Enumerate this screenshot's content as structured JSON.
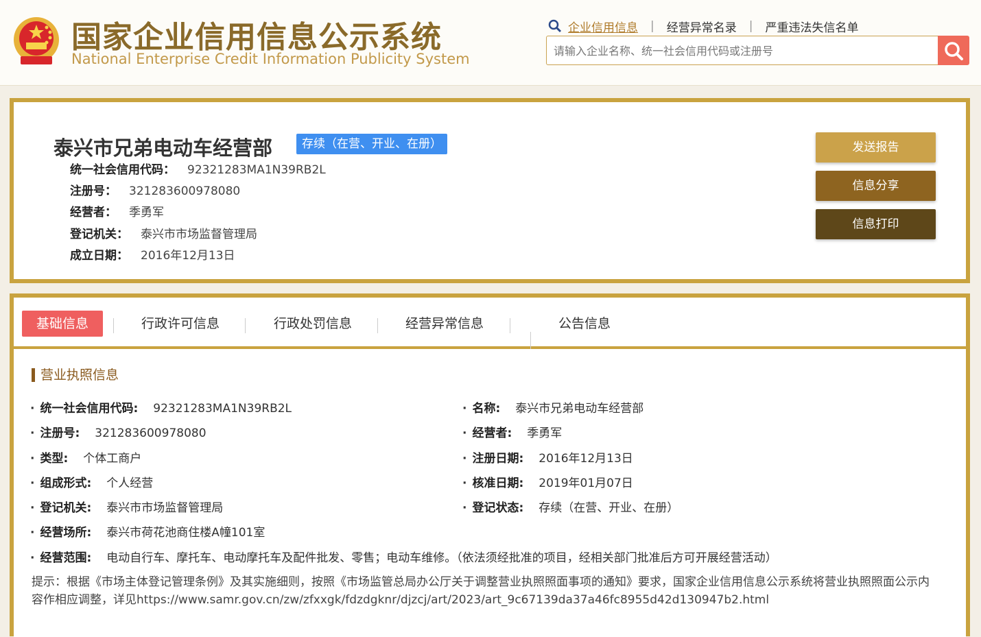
{
  "header": {
    "title_cn": "国家企业信用信息公示系统",
    "title_en": "National Enterprise Credit Information Publicity System",
    "nav": [
      "企业信用信息",
      "经营异常名录",
      "严重违法失信名单"
    ],
    "search_placeholder": "请输入企业名称、统一社会信用代码或注册号"
  },
  "company": {
    "name": "泰兴市兄弟电动车经营部",
    "status": "存续（在营、开业、在册）",
    "rows": [
      {
        "label": "统一社会信用代码：",
        "value": "92321283MA1N39RB2L"
      },
      {
        "label": "注册号：",
        "value": "321283600978080"
      },
      {
        "label": "经营者：",
        "value": "季勇军"
      },
      {
        "label": "登记机关：",
        "value": "泰兴市市场监督管理局"
      },
      {
        "label": "成立日期：",
        "value": "2016年12月13日"
      }
    ],
    "buttons": {
      "send": "发送报告",
      "share": "信息分享",
      "print": "信息打印"
    }
  },
  "tabs": [
    "基础信息",
    "行政许可信息",
    "行政处罚信息",
    "经营异常信息",
    "公告信息"
  ],
  "license": {
    "section_title": "营业执照信息",
    "left": [
      {
        "label": "统一社会信用代码:",
        "value": "92321283MA1N39RB2L"
      },
      {
        "label": "注册号:",
        "value": "321283600978080"
      },
      {
        "label": "类型:",
        "value": "个体工商户"
      },
      {
        "label": "组成形式:",
        "value": "个人经营"
      },
      {
        "label": "登记机关:",
        "value": "泰兴市市场监督管理局"
      },
      {
        "label": "经营场所:",
        "value": "泰兴市荷花池商住楼A幢101室"
      },
      {
        "label": "经营范围:",
        "value": "电动自行车、摩托车、电动摩托车及配件批发、零售；电动车维修。（依法须经批准的项目，经相关部门批准后方可开展经营活动）"
      }
    ],
    "right": [
      {
        "label": "名称:",
        "value": "泰兴市兄弟电动车经营部"
      },
      {
        "label": "经营者:",
        "value": "季勇军"
      },
      {
        "label": "注册日期:",
        "value": "2016年12月13日"
      },
      {
        "label": "核准日期:",
        "value": "2019年01月07日"
      },
      {
        "label": "登记状态:",
        "value": "存续（在营、开业、在册）"
      }
    ],
    "tip": "提示：根据《市场主体登记管理条例》及其实施细则，按照《市场监管总局办公厅关于调整营业执照照面事项的通知》要求，国家企业信用信息公示系统将营业执照照面公示内容作相应调整，详见https://www.samr.gov.cn/zw/zfxxgk/fdzdgknr/djzcj/art/2023/art_9c67139da37a46fc8955d42d130947b2.html"
  },
  "colors": {
    "gold": "#c9a33f",
    "badge": "#3f8ff0",
    "tab_active": "#ef5f5f",
    "search_btn": "#ef6a5a"
  }
}
